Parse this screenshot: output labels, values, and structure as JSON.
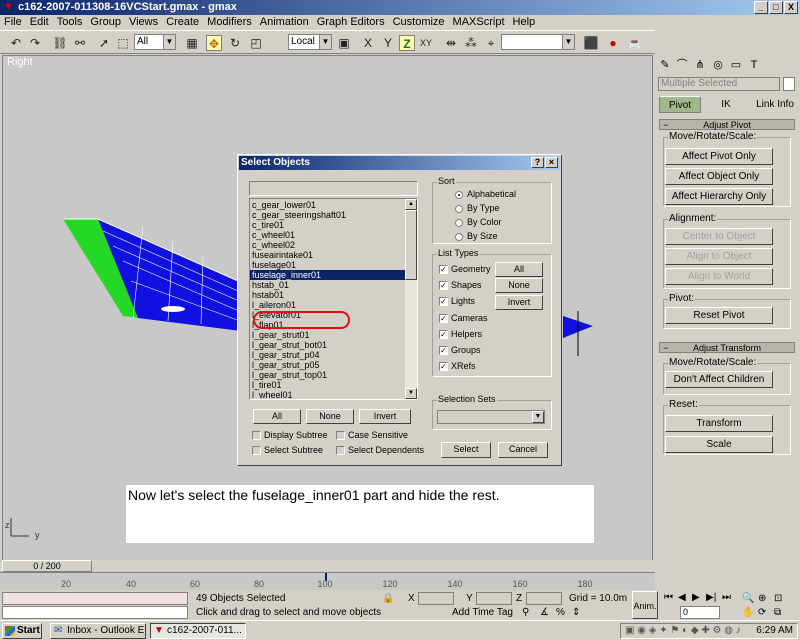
{
  "window": {
    "title": "c162-2007-011308-16VCStart.gmax - gmax",
    "min_label": "_",
    "max_label": "□",
    "close_label": "X"
  },
  "menu": [
    "File",
    "Edit",
    "Tools",
    "Group",
    "Views",
    "Create",
    "Modifiers",
    "Animation",
    "Graph Editors",
    "Customize",
    "MAXScript",
    "Help"
  ],
  "toolbar": {
    "selection_filter": "All",
    "coord_system": "Local",
    "axis_buttons": [
      "X",
      "Y",
      "Z",
      "XY"
    ],
    "named_selection": ""
  },
  "viewport": {
    "label": "Right",
    "axis_y": "y",
    "axis_z": "z"
  },
  "command_panel": {
    "selection_name": "Multiple Selected",
    "subtabs": [
      "Pivot",
      "IK",
      "Link Info"
    ],
    "adjust_pivot": {
      "title": "Adjust Pivot",
      "move_rotate_scale": "Move/Rotate/Scale:",
      "buttons": [
        "Affect Pivot Only",
        "Affect Object Only",
        "Affect Hierarchy Only"
      ],
      "alignment": "Alignment:",
      "align_buttons": [
        "Center to Object",
        "Align to Object",
        "Align to World"
      ],
      "pivot": "Pivot:",
      "reset_pivot": "Reset Pivot"
    },
    "adjust_transform": {
      "title": "Adjust Transform",
      "move_rotate_scale": "Move/Rotate/Scale:",
      "dont_affect": "Don't Affect Children",
      "reset": "Reset:",
      "transform": "Transform",
      "scale": "Scale"
    }
  },
  "timeline": {
    "slider_label": "0 / 200",
    "ticks": [
      "20",
      "40",
      "60",
      "80",
      "100",
      "120",
      "140",
      "160",
      "180"
    ]
  },
  "status": {
    "objects_selected": "49 Objects Selected",
    "prompt": "Click and drag to select and move objects",
    "x_label": "X",
    "y_label": "Y",
    "z_label": "Z",
    "grid": "Grid = 10.0m",
    "add_time_tag": "Add Time Tag",
    "anim": "Anim.",
    "frame": "0"
  },
  "taskbar": {
    "start": "Start",
    "items": [
      "Inbox - Outlook E...",
      "c162-2007-011..."
    ],
    "clock": "6:29 AM"
  },
  "dialog": {
    "title": "Select Objects",
    "help": "?",
    "close": "×",
    "name_filter": "",
    "objects": [
      "c_gear_lower01",
      "c_gear_steeringshaft01",
      "c_tire01",
      "c_wheel01",
      "c_wheel02",
      "fuseairintake01",
      "fuselage01",
      "fuselage_inner01",
      "hstab_01",
      "hstab01",
      "l_aileron01",
      "l_elevator01",
      "l_flap01",
      "l_gear_strut01",
      "l_gear_strut_bot01",
      "l_gear_strut_p04",
      "l_gear_strut_p05",
      "l_gear_strut_top01",
      "l_tire01",
      "l_wheel01"
    ],
    "selected_index": 7,
    "list_buttons": [
      "All",
      "None",
      "Invert"
    ],
    "checks": {
      "display_subtree": "Display Subtree",
      "case_sensitive": "Case Sensitive",
      "select_subtree": "Select Subtree",
      "select_dependents": "Select Dependents"
    },
    "sort": {
      "label": "Sort",
      "options": [
        "Alphabetical",
        "By Type",
        "By Color",
        "By Size"
      ],
      "selected": 0
    },
    "list_types": {
      "label": "List Types",
      "options": [
        "Geometry",
        "Shapes",
        "Lights",
        "Cameras",
        "Helpers",
        "Groups",
        "XRefs"
      ],
      "buttons": [
        "All",
        "None",
        "Invert"
      ]
    },
    "selection_sets": {
      "label": "Selection Sets",
      "value": ""
    },
    "select_button": "Select",
    "cancel_button": "Cancel"
  },
  "caption": "Now let's select the fuselage_inner01 part and hide the rest."
}
